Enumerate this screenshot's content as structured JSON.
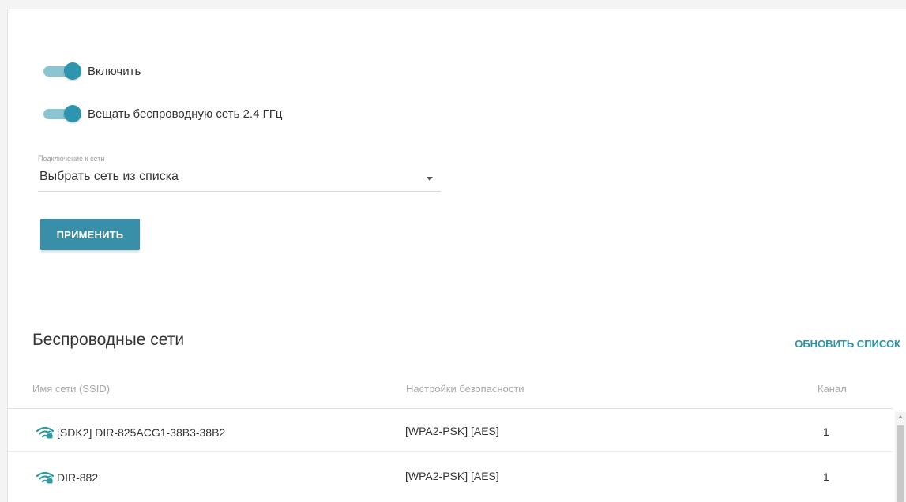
{
  "settings": {
    "enable_label": "Включить",
    "enable_on": true,
    "broadcast_label": "Вещать беспроводную сеть 2.4 ГГц",
    "broadcast_on": true,
    "connection_caption": "Подключение к сети",
    "connection_value": "Выбрать сеть из списка",
    "apply_label": "ПРИМЕНИТЬ"
  },
  "networks": {
    "title": "Беспроводные сети",
    "refresh_label": "ОБНОВИТЬ СПИСОК",
    "columns": [
      "Имя сети (SSID)",
      "Настройки безопасности",
      "Канал"
    ],
    "rows": [
      {
        "ssid": "[SDK2] DIR-825ACG1-38B3-38B2",
        "security": "[WPA2-PSK] [AES]",
        "channel": "1",
        "icon": "wifi-signal-icon"
      },
      {
        "ssid": "DIR-882",
        "security": "[WPA2-PSK] [AES]",
        "channel": "1",
        "icon": "wifi-signal-icon"
      }
    ]
  },
  "colors": {
    "accent": "#2d95ad",
    "toggle_track": "#8cc5d1",
    "button": "#3a8fa8",
    "wifi_icon": "#2f9aa0"
  }
}
